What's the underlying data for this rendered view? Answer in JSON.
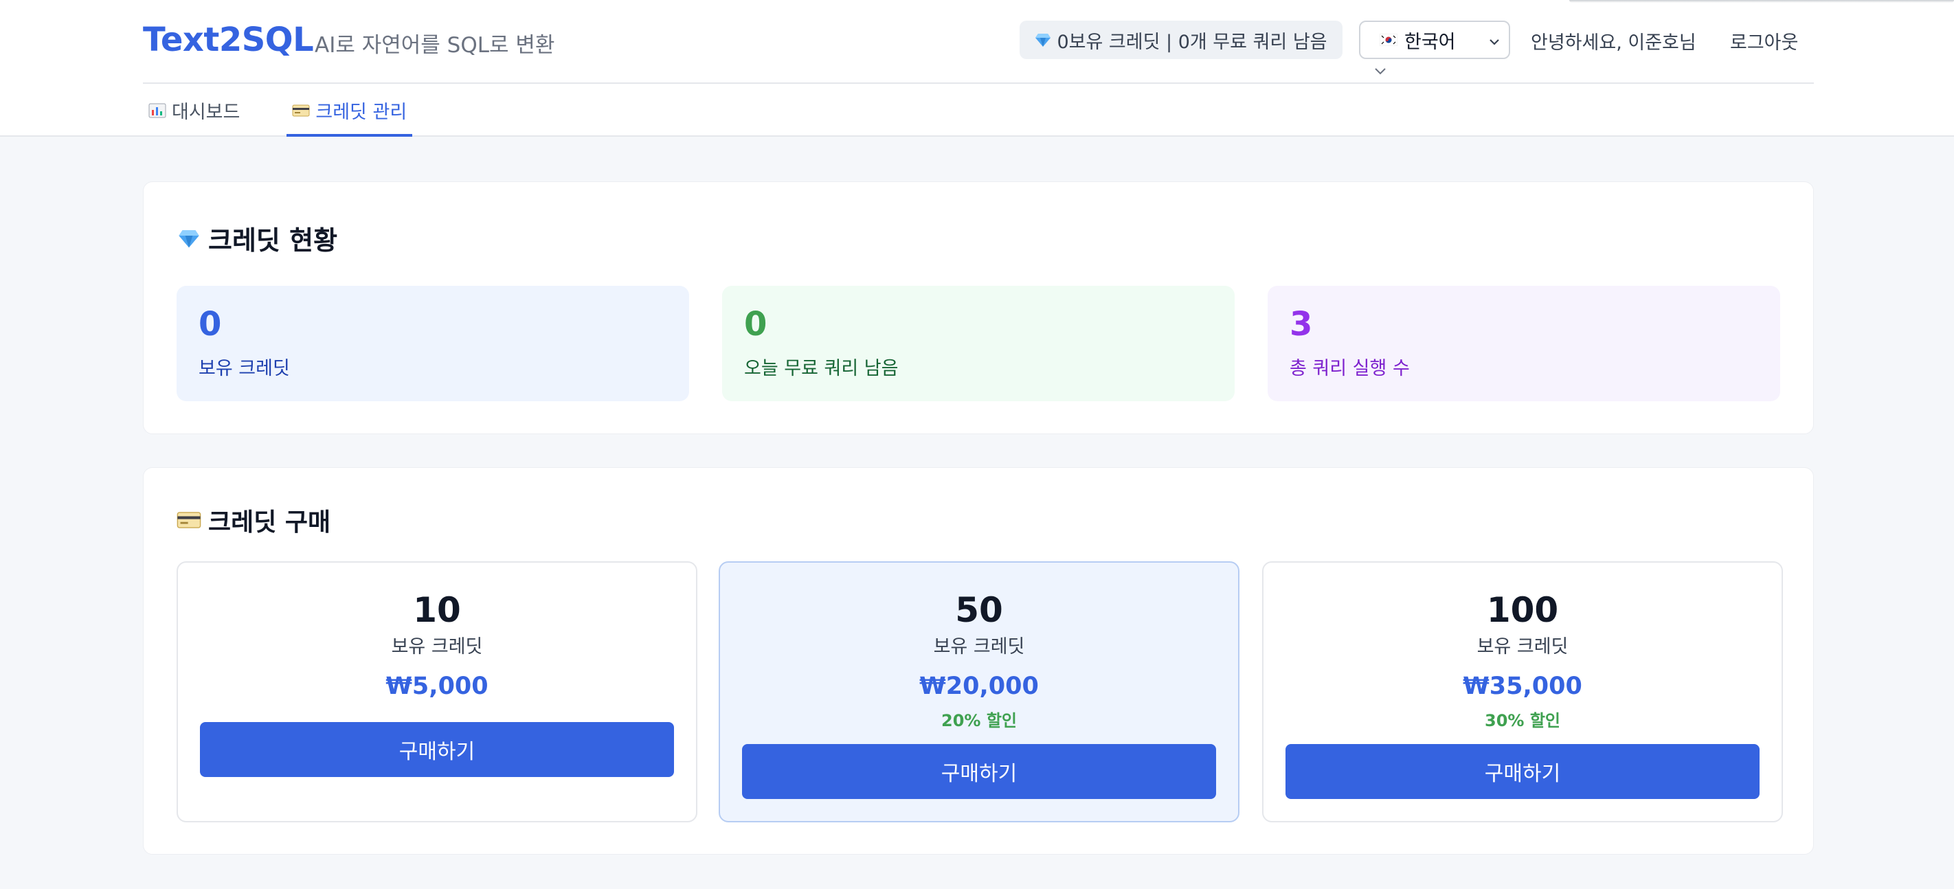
{
  "header": {
    "brand": "Text2SQL",
    "tagline": "AI로 자연어를 SQL로 변환",
    "credit_pill": "0보유 크레딧 | 0개 무료 쿼리 남음",
    "language": "한국어",
    "greeting": "안녕하세요, 이준호님",
    "logout": "로그아웃"
  },
  "tabs": [
    {
      "label": "대시보드",
      "icon": "bar-chart-icon",
      "active": false
    },
    {
      "label": "크레딧 관리",
      "icon": "credit-card-icon",
      "active": true
    }
  ],
  "status": {
    "title": "크레딧 현황",
    "icon": "gem-icon",
    "stats": [
      {
        "value": "0",
        "label": "보유 크레딧",
        "color": "#3563e0"
      },
      {
        "value": "0",
        "label": "오늘 무료 쿼리 남음",
        "color": "#3fa150"
      },
      {
        "value": "3",
        "label": "총 쿼리 실행 수",
        "color": "#9333ea"
      }
    ]
  },
  "purchase": {
    "title": "크레딧 구매",
    "icon": "credit-card-icon",
    "plans": [
      {
        "amount": "10",
        "unit": "보유 크레딧",
        "price": "₩5,000",
        "discount": "",
        "button": "구매하기"
      },
      {
        "amount": "50",
        "unit": "보유 크레딧",
        "price": "₩20,000",
        "discount": "20% 할인",
        "button": "구매하기",
        "highlighted": true
      },
      {
        "amount": "100",
        "unit": "보유 크레딧",
        "price": "₩35,000",
        "discount": "30% 할인",
        "button": "구매하기"
      }
    ]
  },
  "colors": {
    "accent": "#3563e0",
    "success": "#3fa150",
    "purple": "#9333ea"
  }
}
